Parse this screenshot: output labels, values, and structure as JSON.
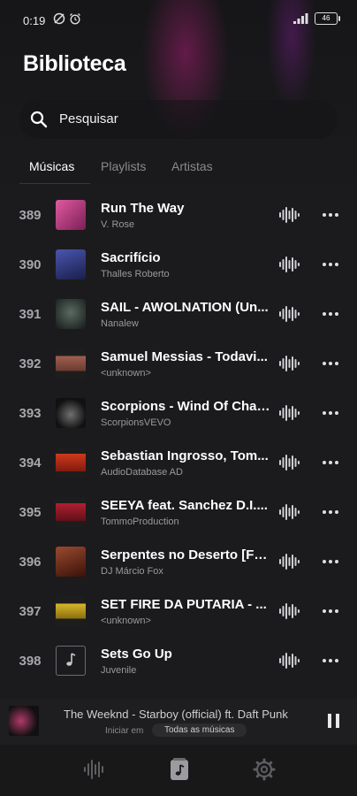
{
  "status_bar": {
    "time": "0:19",
    "battery": "46"
  },
  "page": {
    "title": "Biblioteca"
  },
  "search": {
    "placeholder": "Pesquisar"
  },
  "tabs": [
    {
      "label": "Músicas",
      "active": true
    },
    {
      "label": "Playlists",
      "active": false
    },
    {
      "label": "Artistas",
      "active": false
    }
  ],
  "songs": [
    {
      "number": "389",
      "title": "Run The Way",
      "artist": "V. Rose",
      "art_color": "#c0367e"
    },
    {
      "number": "390",
      "title": "Sacrifício",
      "artist": "Thalles Roberto",
      "art_color": "#3a3f8a"
    },
    {
      "number": "391",
      "title": "SAIL - AWOLNATION (Un...",
      "artist": "Nanalew",
      "art_color": "#2f3a36"
    },
    {
      "number": "392",
      "title": "Samuel Messias - Todavi...",
      "artist": "<unknown>",
      "art_color": "#8a4a3a"
    },
    {
      "number": "393",
      "title": "Scorpions - Wind Of Chan...",
      "artist": "ScorpionsVEVO",
      "art_color": "#3a3a3a"
    },
    {
      "number": "394",
      "title": "Sebastian Ingrosso, Tom...",
      "artist": "AudioDatabase AD",
      "art_color": "#b02818"
    },
    {
      "number": "395",
      "title": "SEEYA feat. Sanchez D.I....",
      "artist": "TommoProduction",
      "art_color": "#a0202a"
    },
    {
      "number": "396",
      "title": "Serpentes no Deserto [Fer...",
      "artist": "DJ Márcio Fox",
      "art_color": "#6a2a1a"
    },
    {
      "number": "397",
      "title": "SET FIRE DA PUTARIA - ...",
      "artist": "<unknown>",
      "art_color": "#b8a020"
    },
    {
      "number": "398",
      "title": "Sets Go Up",
      "artist": "Juvenile",
      "art_color": null
    }
  ],
  "now_playing": {
    "title": "The Weeknd - Starboy (official) ft. Daft Punk",
    "subtitle": "Iniciar em",
    "source": "Todas as músicas"
  },
  "bottom_nav": [
    {
      "icon": "waveform-icon",
      "active": false
    },
    {
      "icon": "music-library-icon",
      "active": true
    },
    {
      "icon": "settings-icon",
      "active": false
    }
  ],
  "colors": {
    "background": "#1b1b1d",
    "text": "#ffffff",
    "muted": "#9a9a9e"
  }
}
